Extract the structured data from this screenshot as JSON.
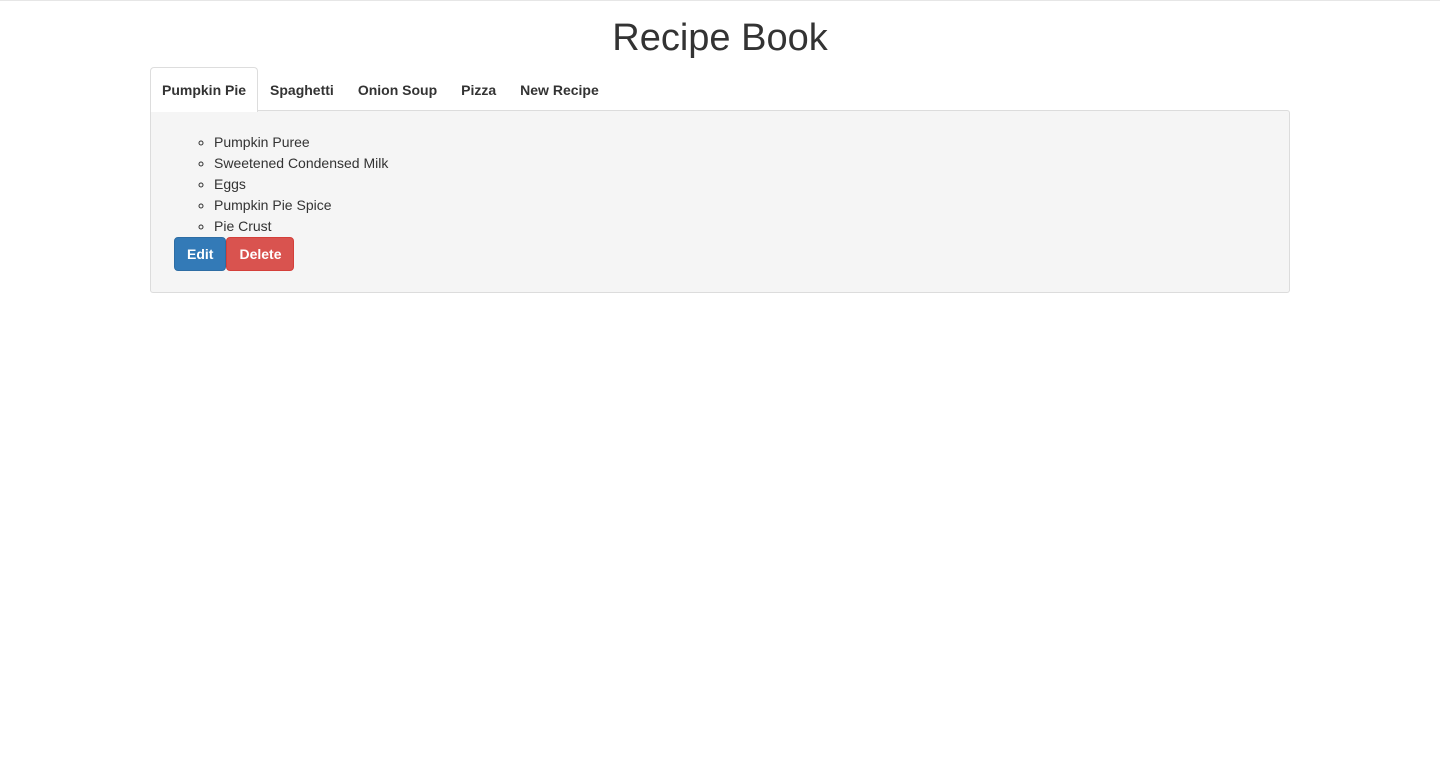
{
  "header": {
    "title": "Recipe Book"
  },
  "tabs": [
    {
      "label": "Pumpkin Pie",
      "active": true
    },
    {
      "label": "Spaghetti",
      "active": false
    },
    {
      "label": "Onion Soup",
      "active": false
    },
    {
      "label": "Pizza",
      "active": false
    },
    {
      "label": "New Recipe",
      "active": false
    }
  ],
  "recipe": {
    "ingredients": [
      "Pumpkin Puree",
      "Sweetened Condensed Milk",
      "Eggs",
      "Pumpkin Pie Spice",
      "Pie Crust"
    ],
    "edit_label": "Edit",
    "delete_label": "Delete"
  },
  "colors": {
    "edit_button": "#337ab7",
    "delete_button": "#d9534f",
    "panel_background": "#f5f5f5"
  }
}
